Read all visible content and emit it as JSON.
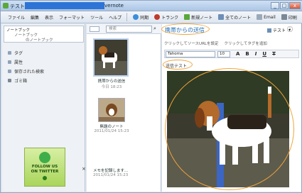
{
  "window": {
    "title": "テスト",
    "app": "vernote",
    "buttons": {
      "min": "_",
      "max": "□",
      "close": "x"
    }
  },
  "menubar": {
    "items": [
      "ファイル",
      "編集",
      "表示",
      "フォーマット",
      "ツール",
      "ヘルプ"
    ]
  },
  "toolbar": {
    "sync": "同期",
    "trunk": "トランク",
    "new_note": "新規ノート",
    "all_notes": "全てのノート",
    "email": "Email",
    "print": "印刷"
  },
  "sidebar": {
    "notebooks_header": "ノートブック",
    "notebook1": "ノートブック",
    "notebook2": "のノートブック",
    "tags": "タグ",
    "attributes": "属性",
    "saved_searches": "保存された検索",
    "trash": "ゴミ箱",
    "twitter": {
      "line1": "FOLLOW US",
      "line2": "ON TWITTER"
    }
  },
  "list": {
    "search_placeholder": "検索",
    "notes": [
      {
        "title": "携帯からの送信",
        "date": "今日 18:23"
      },
      {
        "title": "無題のノート",
        "date": "2011/01/24 15:23"
      },
      {
        "title": "メモを記録します...",
        "date": "2011/01/24 15:23"
      }
    ]
  },
  "editor": {
    "note_title": "携帯からの送信",
    "notebook": "テスト",
    "meta_url": "クリックしてソースURLを設定",
    "meta_tags": "クリックしてタグを追加",
    "font": "Tahoma",
    "size": "10",
    "body": "送信テスト"
  }
}
